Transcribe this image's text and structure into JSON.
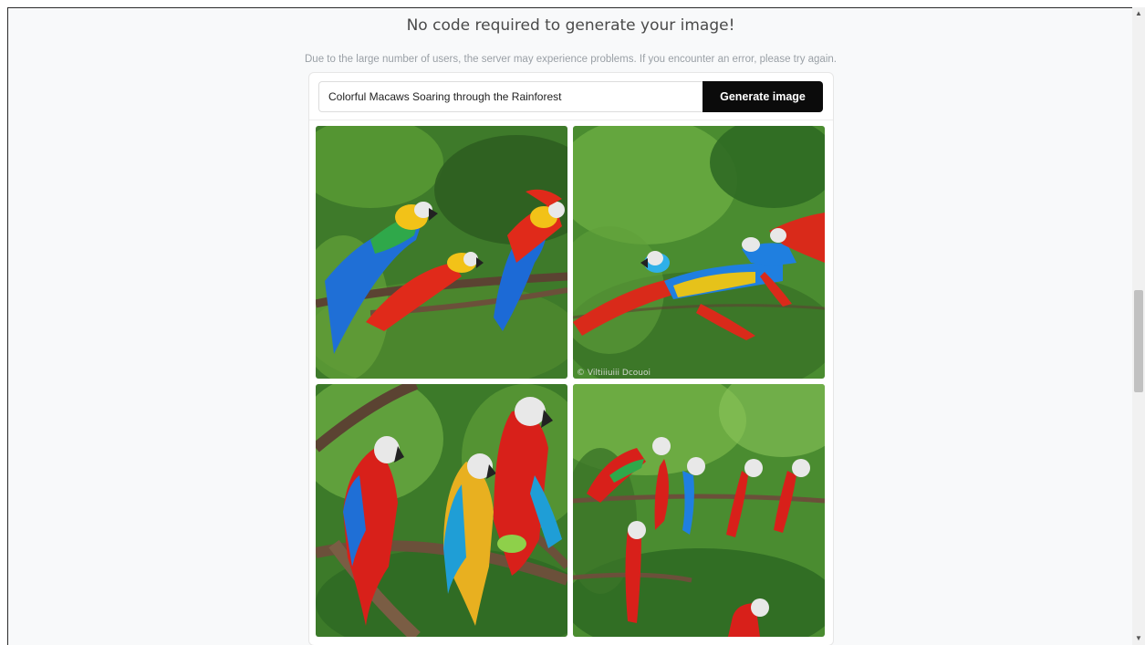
{
  "header": {
    "title": "No code required to generate your image!",
    "notice": "Due to the large number of users, the server may experience problems. If you encounter an error, please try again."
  },
  "prompt": {
    "value": "Colorful Macaws Soaring through the Rainforest",
    "button_label": "Generate image"
  },
  "images": [
    {
      "name": "generated-image-1",
      "subject": "macaws-on-branch"
    },
    {
      "name": "generated-image-2",
      "subject": "macaws-flying",
      "watermark": "© Viltiiiuiii Dcouoi"
    },
    {
      "name": "generated-image-3",
      "subject": "macaws-perched"
    },
    {
      "name": "generated-image-4",
      "subject": "macaws-flock"
    }
  ],
  "colors": {
    "button": "#0b0b0b",
    "page_bg": "#f8f9fa",
    "foliage": "#2f6a24"
  },
  "scrollbar": {
    "up_icon": "▲",
    "down_icon": "▼"
  }
}
